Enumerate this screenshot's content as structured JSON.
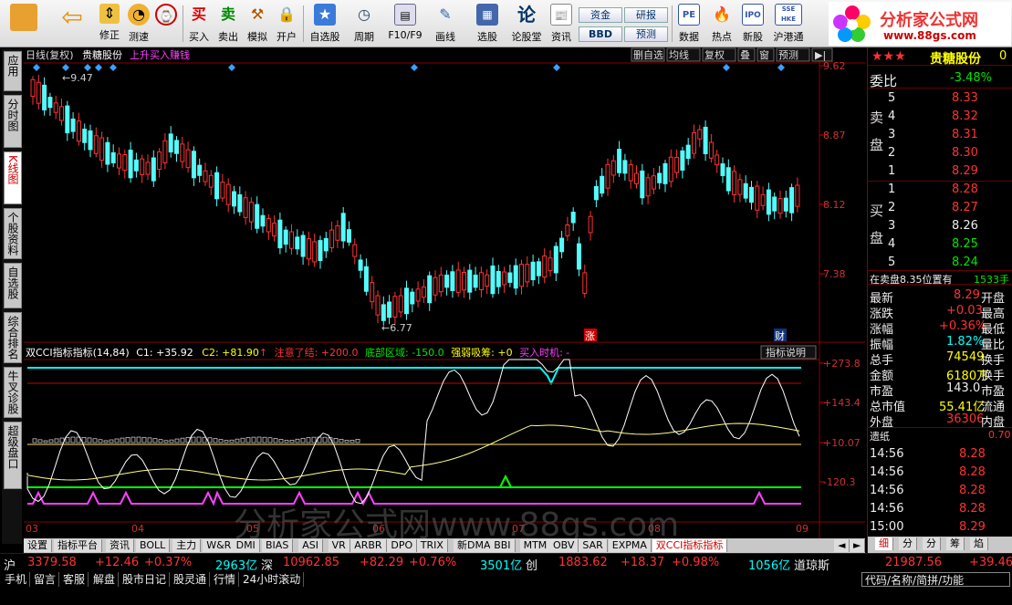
{
  "toolbar": {
    "items": [
      {
        "label": "",
        "icon": "grid-icon"
      },
      {
        "label": "",
        "icon": "back-arrow-icon"
      },
      {
        "label": "修正"
      },
      {
        "label": "测速"
      },
      {
        "label": "买入",
        "glyph": "买"
      },
      {
        "label": "卖出",
        "glyph": "卖"
      },
      {
        "label": "模拟"
      },
      {
        "label": "开户"
      },
      {
        "label": "自选股"
      },
      {
        "label": "周期"
      },
      {
        "label": "F10/F9"
      },
      {
        "label": "画线"
      },
      {
        "label": "选股"
      },
      {
        "label": "论股堂",
        "glyph": "论"
      },
      {
        "label": "资讯"
      },
      {
        "label": "数据",
        "glyph": "PE"
      },
      {
        "label": "热点"
      },
      {
        "label": "新股",
        "glyph": "IPO"
      },
      {
        "label": "沪港通",
        "glyph": "SSE HKE"
      }
    ],
    "small_buttons": [
      "资金",
      "研报",
      "BBD",
      "预测"
    ],
    "logo_title": "分析家公式网",
    "logo_url": "www.88gs.com"
  },
  "side_tabs": [
    "应用",
    "分时图",
    "K线图",
    "个股资料",
    "自选股",
    "综合排名",
    "牛叉诊股",
    "超级盘口"
  ],
  "chart": {
    "header": {
      "period": "日线(复权)",
      "stock": "贵糖股份",
      "strategy": "上升买入赚钱"
    },
    "top_buttons": [
      "删自选",
      "均线",
      "复权",
      "叠",
      "窗",
      "预测"
    ],
    "price_axis": [
      "9.62",
      "8.87",
      "8.12",
      "7.38"
    ],
    "hi_label": "9.47",
    "lo_label": "6.77",
    "marker_zhang": "涨",
    "marker_cai": "财",
    "indicator_header": {
      "name": "双CCI指标指标(14,84)",
      "c1": "C1: +35.92",
      "c2": "C2: +81.90",
      "attention": "注意了结: +200.0",
      "bottom": "底部区域: -150.0",
      "strong": "强弱吸筹: +0",
      "buy": "买入时机: -"
    },
    "indicator_button": "指标说明",
    "ind_axis": [
      "+273.8",
      "+143.4",
      "+10.07",
      "-120.3"
    ],
    "month_labels": [
      "03",
      "04",
      "05",
      "06",
      "07",
      "08",
      "09"
    ],
    "watermark": "分析家公式网www.88gs.com",
    "colors": {
      "up": "#ff3232",
      "down": "#54fcfc",
      "cci1": "#ffffff",
      "cci2": "#ffff80"
    }
  },
  "bottom_tabs": [
    "设置",
    "指标平台",
    "资讯",
    "BOLL",
    "主力",
    "W&R",
    "DMI",
    "BIAS",
    "ASI",
    "VR",
    "ARBR",
    "DPO",
    "TRIX",
    "新DMA",
    "BBI",
    "MTM",
    "OBV",
    "SAR",
    "EXPMA",
    "双CCI指标指标"
  ],
  "right_panel": {
    "stars": "★★★",
    "stock": "贵糖股份",
    "code": "0",
    "weibi_label": "委比",
    "weibi": "-3.48%",
    "sell_label": "卖盘",
    "buy_label": "买盘",
    "sell": [
      {
        "lvl": "5",
        "price": "8.33"
      },
      {
        "lvl": "4",
        "price": "8.32"
      },
      {
        "lvl": "3",
        "price": "8.31"
      },
      {
        "lvl": "2",
        "price": "8.30"
      },
      {
        "lvl": "1",
        "price": "8.29"
      }
    ],
    "buy": [
      {
        "lvl": "1",
        "price": "8.28"
      },
      {
        "lvl": "2",
        "price": "8.27"
      },
      {
        "lvl": "3",
        "price": "8.26"
      },
      {
        "lvl": "4",
        "price": "8.25"
      },
      {
        "lvl": "5",
        "price": "8.24"
      }
    ],
    "position_text": "在卖盘8.35位置有",
    "position_val": "1533手",
    "stats": [
      {
        "k": "最新",
        "v": "8.29",
        "k2": "开盘",
        "c": "red"
      },
      {
        "k": "涨跌",
        "v": "+0.03",
        "k2": "最高",
        "c": "red"
      },
      {
        "k": "涨幅",
        "v": "+0.36%",
        "k2": "最低",
        "c": "red"
      },
      {
        "k": "振幅",
        "v": "1.82%",
        "k2": "量比",
        "c": "cyn"
      },
      {
        "k": "总手",
        "v": "74549",
        "k2": "换手",
        "c": "yel"
      },
      {
        "k": "金额",
        "v": "6180万",
        "k2": "换手",
        "c": "yel"
      },
      {
        "k": "市盈",
        "v": "143.0",
        "k2": "市盈",
        "c": "wht"
      },
      {
        "k": "总市值",
        "v": "55.41亿",
        "k2": "流通",
        "c": "yel"
      },
      {
        "k": "外盘",
        "v": "36306",
        "k2": "内盘",
        "c": "red"
      }
    ],
    "note_label": "遗纸",
    "note_val": "0.70",
    "ticks": [
      {
        "t": "14:56",
        "p": "8.28"
      },
      {
        "t": "14:56",
        "p": "8.28"
      },
      {
        "t": "14:56",
        "p": "8.28"
      },
      {
        "t": "14:56",
        "p": "8.28"
      },
      {
        "t": "15:00",
        "p": "8.29"
      }
    ],
    "tabs": [
      "细",
      "分",
      "分",
      "筹",
      "焰"
    ]
  },
  "status1": {
    "sh": "沪",
    "sh_idx": "3379.58",
    "sh_chg": "+12.46",
    "sh_pct": "+0.37%",
    "sh_amt": "2963亿",
    "sz": "深",
    "sz_idx": "10962.85",
    "sz_chg": "+82.29",
    "sz_pct": "+0.76%",
    "sz_amt": "3501亿",
    "cy": "创",
    "cy_idx": "1883.62",
    "cy_chg": "+18.37",
    "cy_pct": "+0.98%",
    "cy_amt": "1056亿",
    "dj": "道琼斯",
    "dj_idx": "21987.56",
    "dj_chg": "+39.46"
  },
  "status2": [
    "手机",
    "留言",
    "客服",
    "解盘",
    "股市日记",
    "股灵通",
    "行情",
    "24小时滚动"
  ],
  "status2_right": "代码/名称/简拼/功能"
}
